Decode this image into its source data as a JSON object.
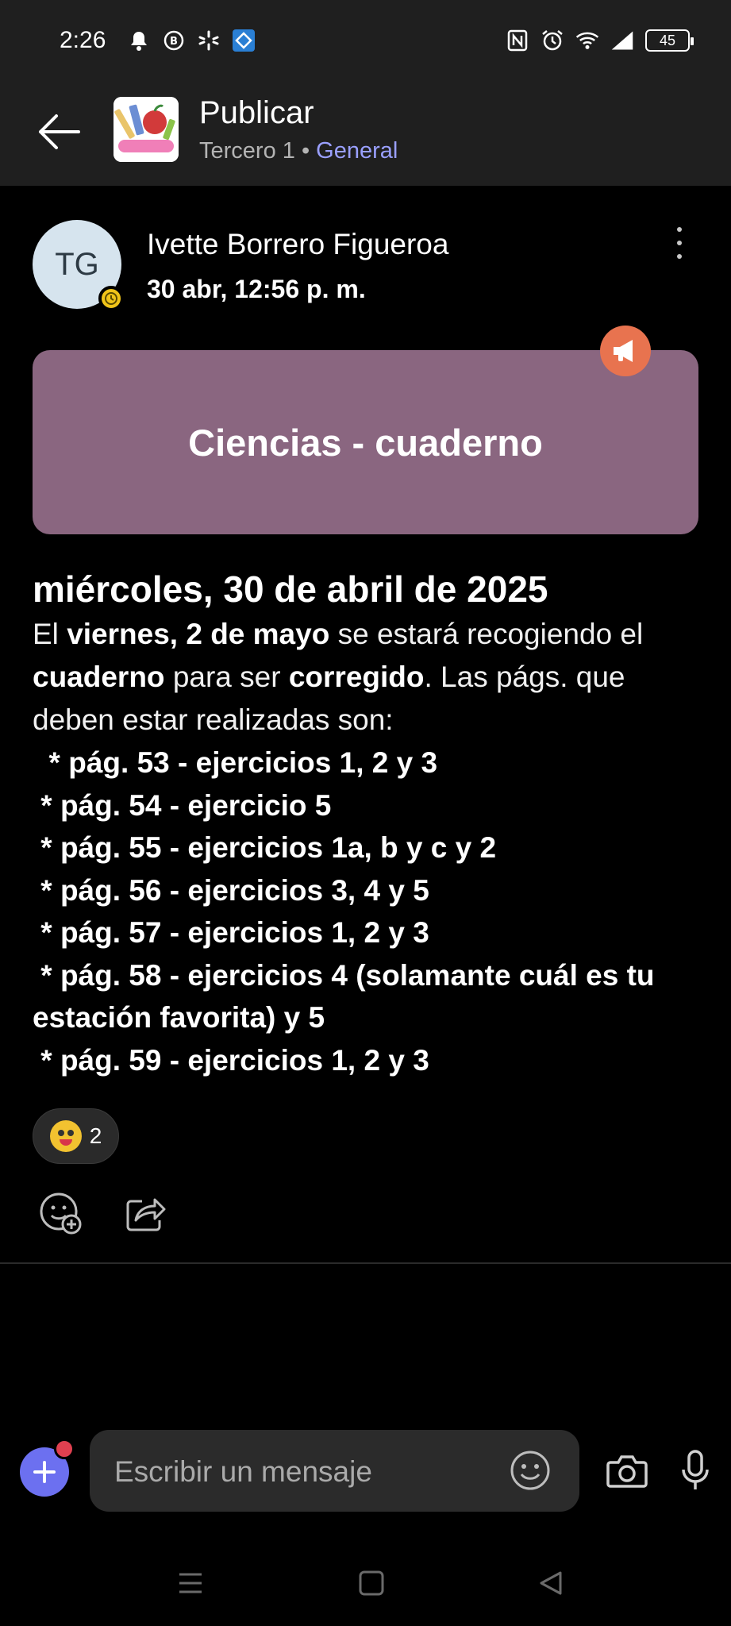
{
  "status_bar": {
    "time": "2:26",
    "battery": "45",
    "left_icons": [
      "bell-icon",
      "b-circle-icon",
      "asterisk-icon",
      "app-diamond-icon"
    ],
    "right_icons": [
      "nfc-icon",
      "alarm-icon",
      "wifi-icon",
      "signal-icon"
    ]
  },
  "header": {
    "title": "Publicar",
    "team": "Tercero 1",
    "separator": "•",
    "channel": "General"
  },
  "post": {
    "avatar_initials": "TG",
    "author": "Ivette Borrero Figueroa",
    "time": "30 abr, 12:56 p. m.",
    "card_title": "Ciencias - cuaderno",
    "heading": "miércoles, 30 de abril de 2025",
    "intro": {
      "t1": "El ",
      "b1": "viernes, 2 de mayo",
      "t2": " se estará recogiendo el ",
      "b2": "cuaderno",
      "t3": " para ser ",
      "b3": "corregido",
      "t4": ". Las págs. que deben estar realizadas son:"
    },
    "list": [
      "  * pág. 53 - ejercicios 1, 2 y 3",
      " * pág. 54 - ejercicio 5",
      " * pág. 55 - ejercicios 1a, b y c y 2",
      " * pág. 56 - ejercicios 3, 4 y 5",
      " * pág. 57 - ejercicios 1, 2 y 3",
      " * pág. 58 - ejercicios 4 (solamante cuál es tu",
      "estación favorita) y 5",
      " * pág. 59 - ejercicios 1, 2 y 3"
    ],
    "reaction_count": "2"
  },
  "composer": {
    "placeholder": "Escribir un mensaje"
  },
  "colors": {
    "card": "#8a6680",
    "announce_badge": "#e8734f",
    "link": "#9aa0ff",
    "compose_plus": "#6c70f0"
  }
}
